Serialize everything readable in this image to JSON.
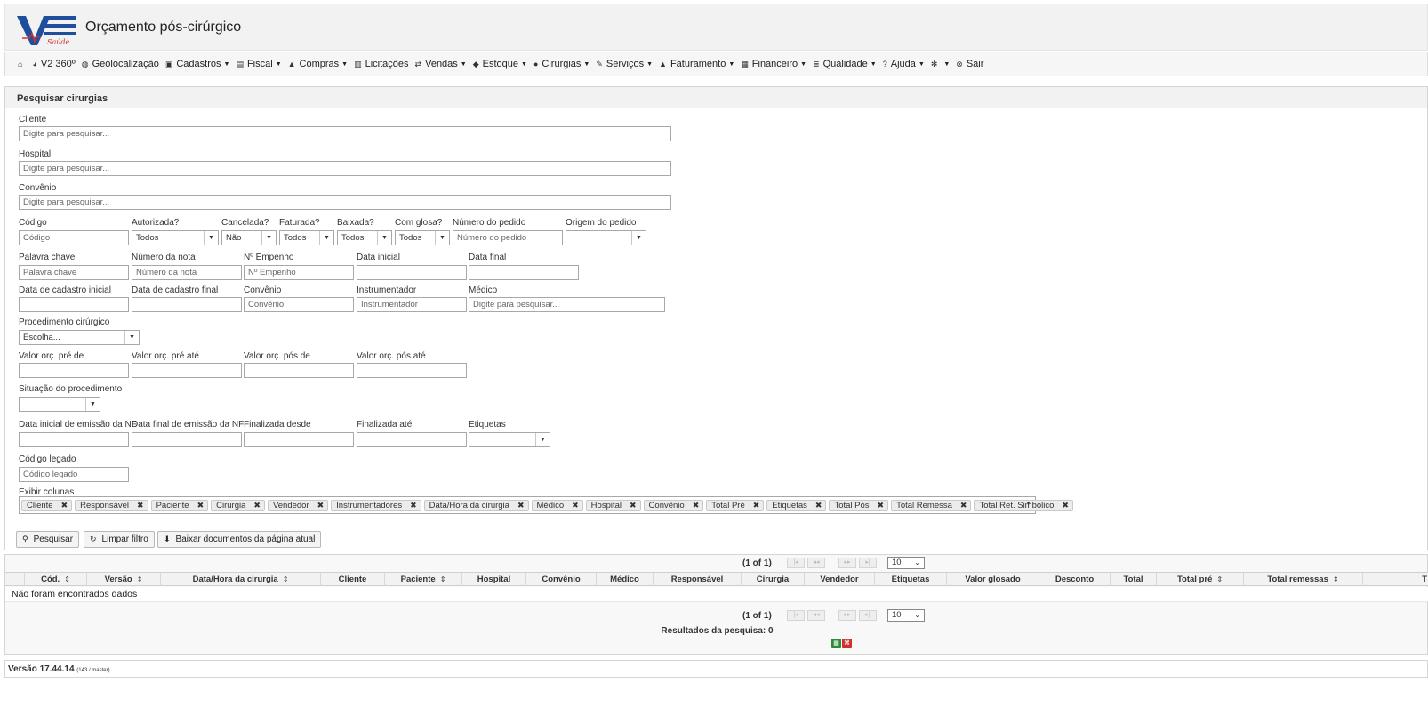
{
  "app": {
    "brand": "V2 Saúde",
    "title": "Orçamento pós-cirúrgico",
    "brand_color": "#1f4e9c",
    "accent_red": "#d32f2f"
  },
  "menu": [
    {
      "icon": "⌂",
      "icon_name": "home-icon",
      "label": "",
      "caret": false
    },
    {
      "icon": "◕",
      "icon_name": "chart-pie-icon",
      "label": "V2 360º",
      "caret": false
    },
    {
      "icon": "◍",
      "icon_name": "globe-icon",
      "label": "Geolocalização",
      "caret": false
    },
    {
      "icon": "▣",
      "icon_name": "archive-icon",
      "label": "Cadastros",
      "caret": true
    },
    {
      "icon": "▤",
      "icon_name": "receipt-icon",
      "label": "Fiscal",
      "caret": true
    },
    {
      "icon": "▲",
      "icon_name": "cart-icon",
      "label": "Compras",
      "caret": true
    },
    {
      "icon": "▥",
      "icon_name": "building-icon",
      "label": "Licitações",
      "caret": false
    },
    {
      "icon": "⇄",
      "icon_name": "exchange-icon",
      "label": "Vendas",
      "caret": true
    },
    {
      "icon": "◆",
      "icon_name": "tag-icon",
      "label": "Estoque",
      "caret": true
    },
    {
      "icon": "●",
      "icon_name": "plus-circle-icon",
      "label": "Cirurgias",
      "caret": true
    },
    {
      "icon": "✎",
      "icon_name": "wrench-icon",
      "label": "Serviços",
      "caret": true
    },
    {
      "icon": "▲",
      "icon_name": "bank-icon",
      "label": "Faturamento",
      "caret": true
    },
    {
      "icon": "▦",
      "icon_name": "money-icon",
      "label": "Financeiro",
      "caret": true
    },
    {
      "icon": "≣",
      "icon_name": "list-icon",
      "label": "Qualidade",
      "caret": true
    },
    {
      "icon": "?",
      "icon_name": "question-icon",
      "label": "Ajuda",
      "caret": true
    },
    {
      "icon": "✻",
      "icon_name": "gear-icon",
      "label": "",
      "caret": true
    },
    {
      "icon": "⊗",
      "icon_name": "power-off-icon",
      "label": "Sair",
      "caret": false
    }
  ],
  "search": {
    "panel_title": "Pesquisar cirurgias",
    "cliente": {
      "label": "Cliente",
      "placeholder": "Digite para pesquisar..."
    },
    "hospital": {
      "label": "Hospital",
      "placeholder": "Digite para pesquisar..."
    },
    "convenio_top": {
      "label": "Convênio",
      "placeholder": "Digite para pesquisar..."
    },
    "codigo": {
      "label": "Código",
      "placeholder": "Código"
    },
    "autorizada": {
      "label": "Autorizada?",
      "value": "Todos"
    },
    "cancelada": {
      "label": "Cancelada?",
      "value": "Não"
    },
    "faturada": {
      "label": "Faturada?",
      "value": "Todos"
    },
    "baixada": {
      "label": "Baixada?",
      "value": "Todos"
    },
    "com_glosa": {
      "label": "Com glosa?",
      "value": "Todos"
    },
    "numero_pedido": {
      "label": "Número do pedido",
      "placeholder": "Número do pedido"
    },
    "origem_pedido": {
      "label": "Origem do pedido",
      "value": ""
    },
    "palavra_chave": {
      "label": "Palavra chave",
      "placeholder": "Palavra chave"
    },
    "numero_nota": {
      "label": "Número da nota",
      "placeholder": "Número da nota"
    },
    "empenho": {
      "label": "Nº Empenho",
      "placeholder": "Nº Empenho"
    },
    "data_inicial": {
      "label": "Data inicial"
    },
    "data_final": {
      "label": "Data final"
    },
    "data_cadastro_inicial": {
      "label": "Data de cadastro inicial"
    },
    "data_cadastro_final": {
      "label": "Data de cadastro final"
    },
    "convenio": {
      "label": "Convênio",
      "placeholder": "Convênio"
    },
    "instrumentador": {
      "label": "Instrumentador",
      "placeholder": "Instrumentador"
    },
    "medico": {
      "label": "Médico",
      "placeholder": "Digite para pesquisar..."
    },
    "procedimento": {
      "label": "Procedimento cirúrgico",
      "value": "Escolha..."
    },
    "valor_pre_de": {
      "label": "Valor orç. pré de"
    },
    "valor_pre_ate": {
      "label": "Valor orç. pré até"
    },
    "valor_pos_de": {
      "label": "Valor orç. pós de"
    },
    "valor_pos_ate": {
      "label": "Valor orç. pós até"
    },
    "situacao": {
      "label": "Situação do procedimento",
      "value": ""
    },
    "data_emissao_inicial": {
      "label": "Data inicial de emissão da NF"
    },
    "data_emissao_final": {
      "label": "Data final de emissão da NF"
    },
    "finalizada_desde": {
      "label": "Finalizada desde"
    },
    "finalizada_ate": {
      "label": "Finalizada até"
    },
    "etiquetas": {
      "label": "Etiquetas",
      "value": ""
    },
    "codigo_legado": {
      "label": "Código legado",
      "placeholder": "Código legado"
    },
    "exibir_colunas": {
      "label": "Exibir colunas",
      "chips": [
        "Cliente",
        "Responsável",
        "Paciente",
        "Cirurgia",
        "Vendedor",
        "Instrumentadores",
        "Data/Hora da cirurgia",
        "Médico",
        "Hospital",
        "Convênio",
        "Total Pré",
        "Etiquetas",
        "Total Pós",
        "Total Remessa",
        "Total Ret. Simbólico"
      ]
    },
    "buttons": {
      "pesquisar": "Pesquisar",
      "limpar": "Limpar filtro",
      "baixar": "Baixar documentos da página atual"
    }
  },
  "results": {
    "page_info": "(1 of 1)",
    "rows_per_page": "10",
    "columns": [
      "Cód.",
      "Versão",
      "Data/Hora da cirurgia",
      "Cliente",
      "Paciente",
      "Hospital",
      "Convênio",
      "Médico",
      "Responsável",
      "Cirurgia",
      "Vendedor",
      "Etiquetas",
      "Valor glosado",
      "Desconto",
      "Total",
      "Total pré",
      "Total remessas",
      "T"
    ],
    "empty_message": "Não foram encontrados dados",
    "summary": "Resultados da pesquisa: 0"
  },
  "footer": {
    "version": "Versão 17.44.14",
    "build": "(143 / master)"
  }
}
